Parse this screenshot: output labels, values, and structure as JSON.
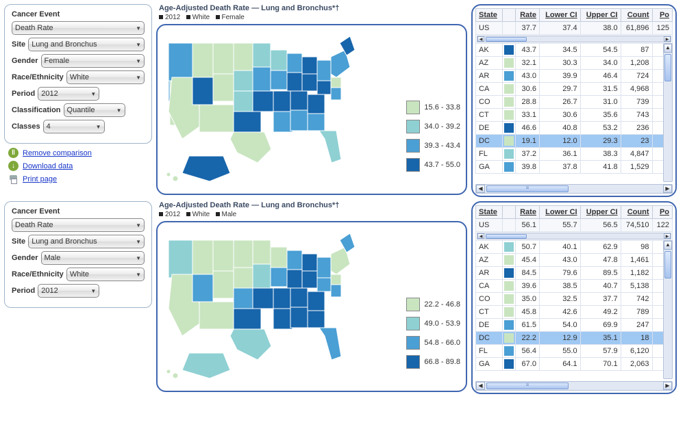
{
  "legend_colors": [
    "#c9e5c0",
    "#8fd0d3",
    "#4a9fd4",
    "#1765ab"
  ],
  "panel1": {
    "header": "Cancer Event",
    "event": "Death Rate",
    "site_label": "Site",
    "site": "Lung and Bronchus",
    "gender_label": "Gender",
    "gender": "Female",
    "race_label": "Race/Ethnicity",
    "race": "White",
    "period_label": "Period",
    "period": "2012",
    "class_label": "Classification",
    "classification": "Quantile",
    "classes_label": "Classes",
    "classes": "4"
  },
  "actions": {
    "remove": "Remove comparison",
    "download": "Download data",
    "print": "Print page"
  },
  "panel2": {
    "header": "Cancer Event",
    "event": "Death Rate",
    "site_label": "Site",
    "site": "Lung and Bronchus",
    "gender_label": "Gender",
    "gender": "Male",
    "race_label": "Race/Ethnicity",
    "race": "White",
    "period_label": "Period",
    "period": "2012"
  },
  "map1": {
    "title": "Age-Adjusted Death Rate — Lung and Bronchus*†",
    "tags": [
      "2012",
      "White",
      "Female"
    ],
    "legend": [
      "15.6 - 33.8",
      "34.0 - 39.2",
      "39.3 - 43.4",
      "43.7 - 55.0"
    ]
  },
  "map2": {
    "title": "Age-Adjusted Death Rate — Lung and Bronchus*†",
    "tags": [
      "2012",
      "White",
      "Male"
    ],
    "legend": [
      "22.2 - 46.8",
      "49.0 - 53.9",
      "54.8 - 66.0",
      "66.8 - 89.8"
    ]
  },
  "table_headers": [
    "State",
    "",
    "Rate",
    "Lower CI",
    "Upper CI",
    "Count",
    "Po"
  ],
  "table1": {
    "us": {
      "state": "US",
      "rate": "37.7",
      "low": "37.4",
      "up": "38.0",
      "count": "61,896",
      "pop": "125"
    },
    "rows": [
      {
        "state": "AK",
        "color": 3,
        "rate": "43.7",
        "low": "34.5",
        "up": "54.5",
        "count": "87"
      },
      {
        "state": "AZ",
        "color": 0,
        "rate": "32.1",
        "low": "30.3",
        "up": "34.0",
        "count": "1,208"
      },
      {
        "state": "AR",
        "color": 2,
        "rate": "43.0",
        "low": "39.9",
        "up": "46.4",
        "count": "724"
      },
      {
        "state": "CA",
        "color": 0,
        "rate": "30.6",
        "low": "29.7",
        "up": "31.5",
        "count": "4,968"
      },
      {
        "state": "CO",
        "color": 0,
        "rate": "28.8",
        "low": "26.7",
        "up": "31.0",
        "count": "739"
      },
      {
        "state": "CT",
        "color": 0,
        "rate": "33.1",
        "low": "30.6",
        "up": "35.6",
        "count": "743"
      },
      {
        "state": "DE",
        "color": 3,
        "rate": "46.6",
        "low": "40.8",
        "up": "53.2",
        "count": "236"
      },
      {
        "state": "DC",
        "color": 0,
        "rate": "19.1",
        "low": "12.0",
        "up": "29.3",
        "count": "23",
        "hl": true
      },
      {
        "state": "FL",
        "color": 1,
        "rate": "37.2",
        "low": "36.1",
        "up": "38.3",
        "count": "4,847"
      },
      {
        "state": "GA",
        "color": 2,
        "rate": "39.8",
        "low": "37.8",
        "up": "41.8",
        "count": "1,529"
      }
    ]
  },
  "table2": {
    "us": {
      "state": "US",
      "rate": "56.1",
      "low": "55.7",
      "up": "56.5",
      "count": "74,510",
      "pop": "122"
    },
    "rows": [
      {
        "state": "AK",
        "color": 1,
        "rate": "50.7",
        "low": "40.1",
        "up": "62.9",
        "count": "98"
      },
      {
        "state": "AZ",
        "color": 0,
        "rate": "45.4",
        "low": "43.0",
        "up": "47.8",
        "count": "1,461"
      },
      {
        "state": "AR",
        "color": 3,
        "rate": "84.5",
        "low": "79.6",
        "up": "89.5",
        "count": "1,182"
      },
      {
        "state": "CA",
        "color": 0,
        "rate": "39.6",
        "low": "38.5",
        "up": "40.7",
        "count": "5,138"
      },
      {
        "state": "CO",
        "color": 0,
        "rate": "35.0",
        "low": "32.5",
        "up": "37.7",
        "count": "742"
      },
      {
        "state": "CT",
        "color": 0,
        "rate": "45.8",
        "low": "42.6",
        "up": "49.2",
        "count": "789"
      },
      {
        "state": "DE",
        "color": 2,
        "rate": "61.5",
        "low": "54.0",
        "up": "69.9",
        "count": "247"
      },
      {
        "state": "DC",
        "color": 0,
        "rate": "22.2",
        "low": "12.9",
        "up": "35.1",
        "count": "18",
        "hl": true
      },
      {
        "state": "FL",
        "color": 2,
        "rate": "56.4",
        "low": "55.0",
        "up": "57.9",
        "count": "6,120"
      },
      {
        "state": "GA",
        "color": 3,
        "rate": "67.0",
        "low": "64.1",
        "up": "70.1",
        "count": "2,063"
      }
    ]
  },
  "chart_data": [
    {
      "type": "choropleth-map",
      "title": "Age-Adjusted Death Rate — Lung and Bronchus (2012, White, Female)",
      "bins": [
        {
          "range": "15.6 - 33.8",
          "color": "#c9e5c0"
        },
        {
          "range": "34.0 - 39.2",
          "color": "#8fd0d3"
        },
        {
          "range": "39.3 - 43.4",
          "color": "#4a9fd4"
        },
        {
          "range": "43.7 - 55.0",
          "color": "#1765ab"
        }
      ],
      "values": {
        "US": 37.7,
        "AK": 43.7,
        "AZ": 32.1,
        "AR": 43.0,
        "CA": 30.6,
        "CO": 28.8,
        "CT": 33.1,
        "DE": 46.6,
        "DC": 19.1,
        "FL": 37.2,
        "GA": 39.8
      }
    },
    {
      "type": "choropleth-map",
      "title": "Age-Adjusted Death Rate — Lung and Bronchus (2012, White, Male)",
      "bins": [
        {
          "range": "22.2 - 46.8",
          "color": "#c9e5c0"
        },
        {
          "range": "49.0 - 53.9",
          "color": "#8fd0d3"
        },
        {
          "range": "54.8 - 66.0",
          "color": "#4a9fd4"
        },
        {
          "range": "66.8 - 89.8",
          "color": "#1765ab"
        }
      ],
      "values": {
        "US": 56.1,
        "AK": 50.7,
        "AZ": 45.4,
        "AR": 84.5,
        "CA": 39.6,
        "CO": 35.0,
        "CT": 45.8,
        "DE": 61.5,
        "DC": 22.2,
        "FL": 56.4,
        "GA": 67.0
      }
    }
  ]
}
